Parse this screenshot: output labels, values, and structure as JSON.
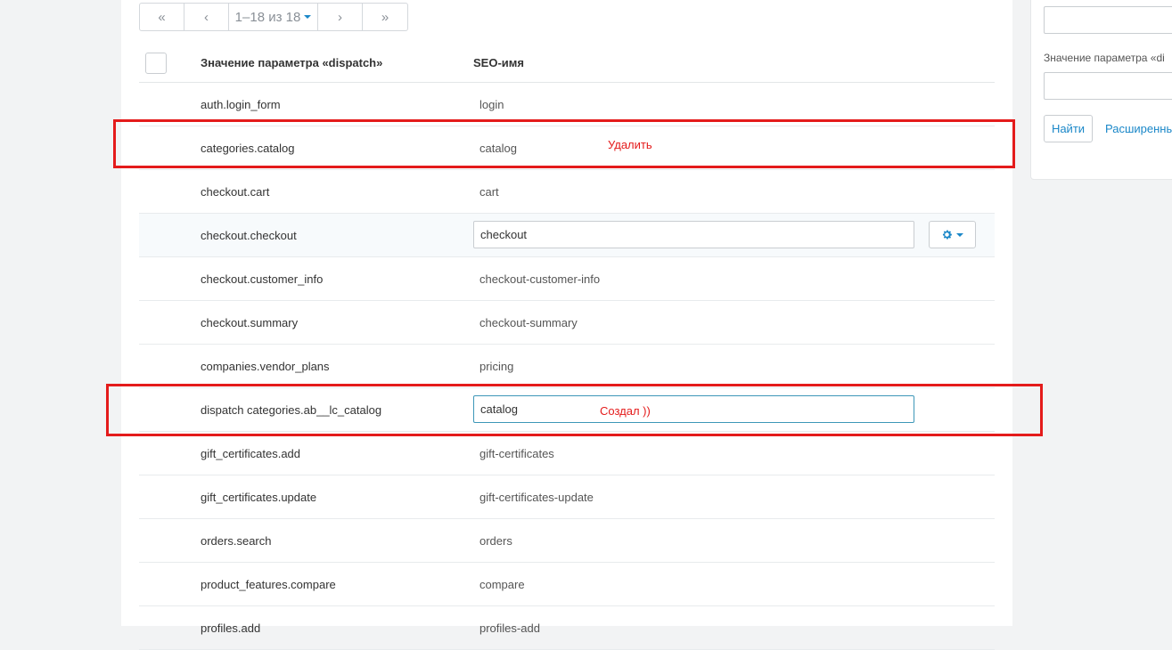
{
  "pagination": {
    "first": "«",
    "prev": "‹",
    "info": "1–18 из 18",
    "next": "›",
    "last": "»"
  },
  "table": {
    "headers": {
      "param": "Значение параметра «dispatch»",
      "seo": "SEO-имя"
    },
    "rows": [
      {
        "param": "auth.login_form",
        "seo": "login"
      },
      {
        "param": "categories.catalog",
        "seo": "catalog"
      },
      {
        "param": "checkout.cart",
        "seo": "cart"
      },
      {
        "param": "checkout.checkout",
        "seo": "checkout"
      },
      {
        "param": "checkout.customer_info",
        "seo": "checkout-customer-info"
      },
      {
        "param": "checkout.summary",
        "seo": "checkout-summary"
      },
      {
        "param": "companies.vendor_plans",
        "seo": "pricing"
      },
      {
        "param": "dispatch categories.ab__lc_catalog",
        "seo": "catalog"
      },
      {
        "param": "gift_certificates.add",
        "seo": "gift-certificates"
      },
      {
        "param": "gift_certificates.update",
        "seo": "gift-certificates-update"
      },
      {
        "param": "orders.search",
        "seo": "orders"
      },
      {
        "param": "product_features.compare",
        "seo": "compare"
      },
      {
        "param": "profiles.add",
        "seo": "profiles-add"
      }
    ]
  },
  "annotations": {
    "delete": "Удалить",
    "created": "Создал ))"
  },
  "sidebar": {
    "label": "Значение параметра «di",
    "search_button": "Найти",
    "advanced_link": "Расширенный"
  },
  "colors": {
    "accent": "#1a87c8",
    "annotation": "#e41b1b"
  }
}
